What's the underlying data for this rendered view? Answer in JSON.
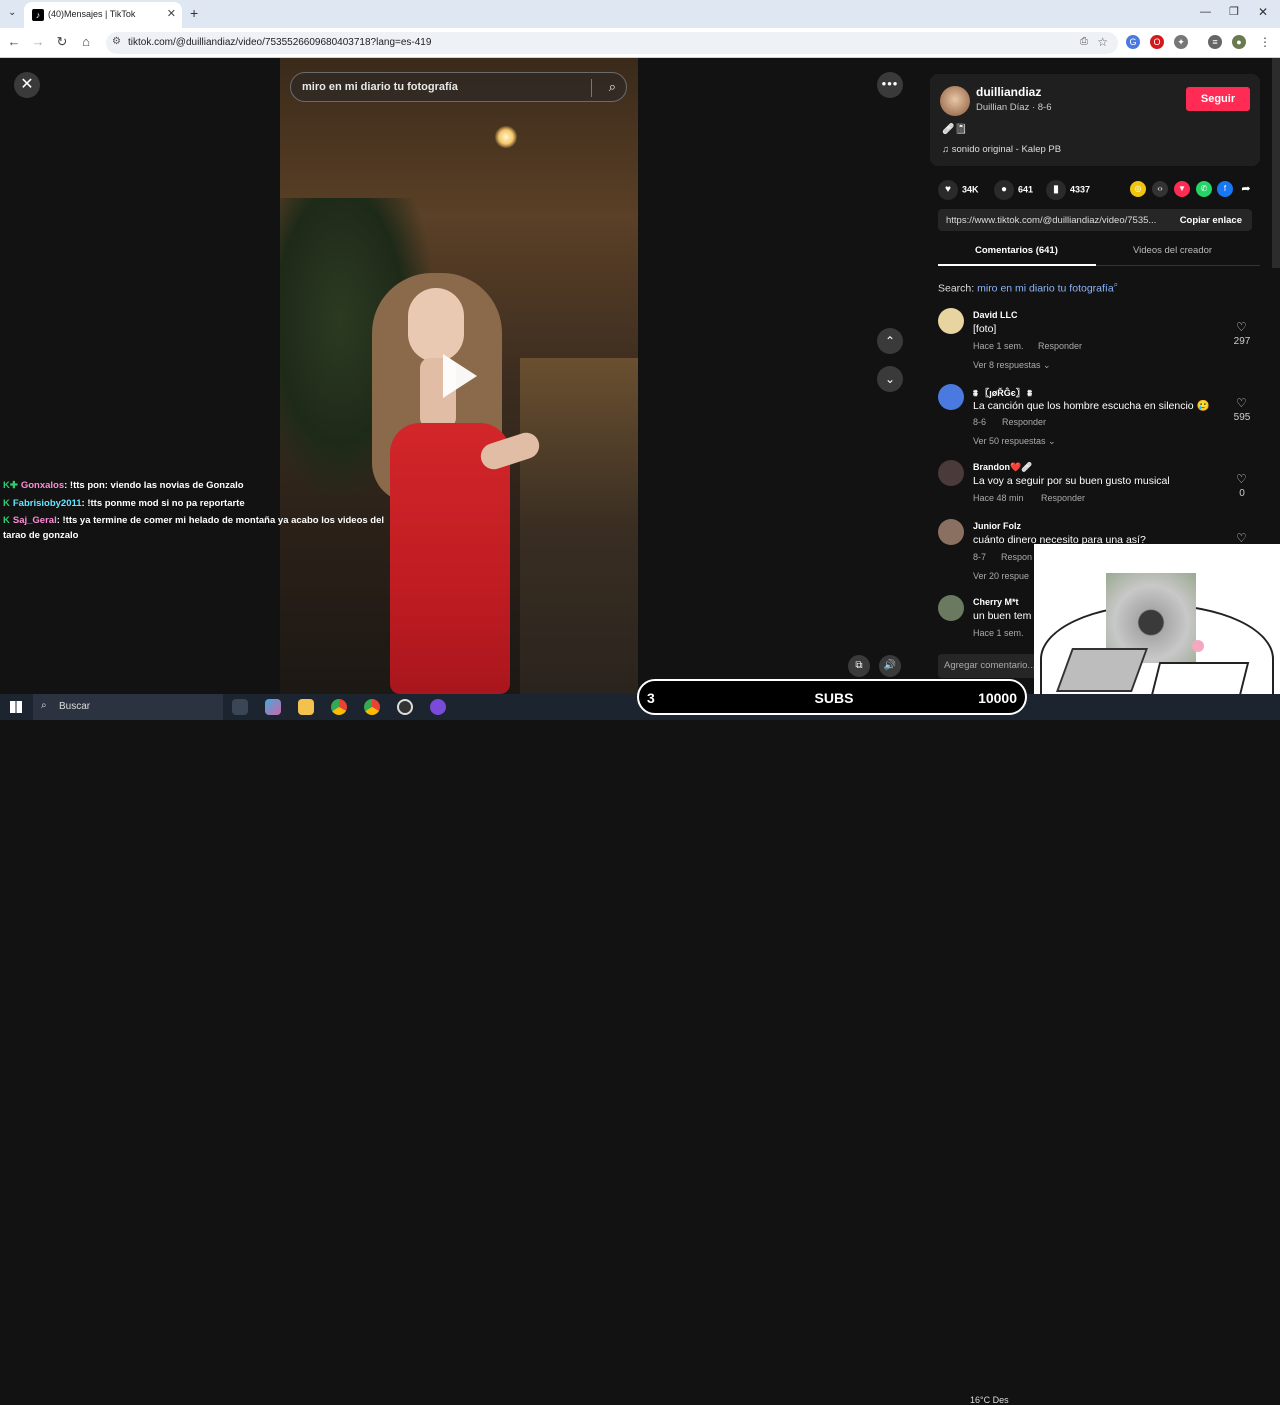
{
  "browser": {
    "tab_title": "(40)Mensajes | TikTok",
    "url": "tiktok.com/@duilliandiaz/video/7535526609680403718?lang=es-419"
  },
  "video": {
    "search_text": "miro en mi diario tu fotografía"
  },
  "chat": [
    {
      "user": "Gonxalos",
      "user_color": "#ff8ad8",
      "message": ": !tts pon: viendo las novias de Gonzalo"
    },
    {
      "user": "Fabrisioby2011",
      "user_color": "#63e6ff",
      "message": ": !tts ponme mod si no pa reportarte"
    },
    {
      "user": "Saj_Geral",
      "user_color": "#ff8ad8",
      "message": ": !tts ya termine de comer mi helado de montaña ya acabo los videos del"
    },
    {
      "continuation": "tarao de gonzalo"
    }
  ],
  "creator": {
    "handle": "duilliandiaz",
    "sub": "Duillian Díaz · 8-6",
    "follow_label": "Seguir",
    "desc_emoji": "🩹📓",
    "sound": "sonido original - Kalep PB"
  },
  "stats": {
    "likes": "34K",
    "comments": "641",
    "saves": "4337"
  },
  "share": {
    "link": "https://www.tiktok.com/@duilliandiaz/video/7535...",
    "copy_label": "Copiar enlace"
  },
  "tabs": {
    "comments": "Comentarios (641)",
    "creator_videos": "Videos del creador"
  },
  "search_line": {
    "prefix": "Search: ",
    "query": "miro en mi diario tu fotografía"
  },
  "comments": [
    {
      "name": "David LLC",
      "text": "[foto]",
      "time": "Hace 1 sem.",
      "reply": "Responder",
      "more": "Ver 8 respuestas ⌄",
      "likes": "297"
    },
    {
      "name": "⩩ 〖ȷøŘĜє〗 ⩩",
      "text": "La canción que los hombre escucha en silencio 🥲",
      "time": "8-6",
      "reply": "Responder",
      "more": "Ver 50 respuestas ⌄",
      "likes": "595"
    },
    {
      "name": "Brandon❤️🩹",
      "text": "La voy a seguir por su buen gusto musical",
      "time": "Hace 48 min",
      "reply": "Responder",
      "more": "",
      "likes": "0"
    },
    {
      "name": "Junior Folz",
      "text": "cuánto dinero necesito para una así?",
      "time": "8-7",
      "reply": "Respon",
      "more": "Ver 20 respue",
      "likes": ""
    },
    {
      "name": "Cherry M*t",
      "text": "un buen tem",
      "time": "Hace 1 sem.",
      "reply": "",
      "more": "",
      "likes": ""
    }
  ],
  "add_comment_placeholder": "Agregar comentario...",
  "subs_bar": {
    "current": "3",
    "label": "SUBS",
    "goal": "10000"
  },
  "taskbar": {
    "search": "Buscar",
    "weather": "16°C  Des"
  }
}
